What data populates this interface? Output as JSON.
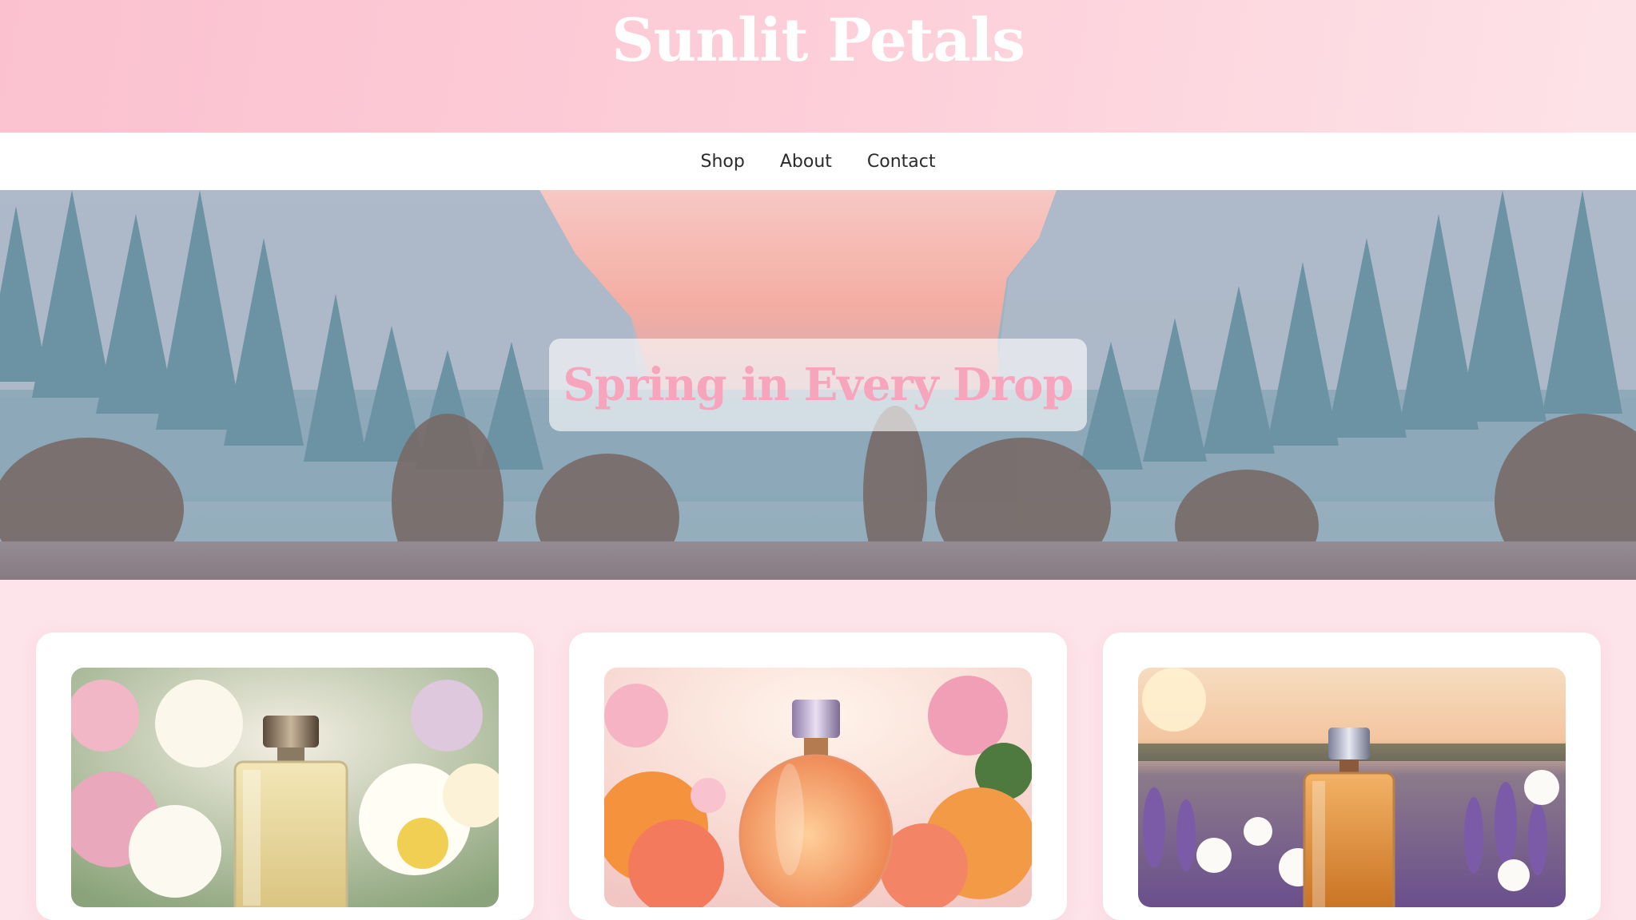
{
  "header": {
    "site_title": "Sunlit Petals"
  },
  "nav": {
    "items": [
      {
        "label": "Shop"
      },
      {
        "label": "About"
      },
      {
        "label": "Contact"
      }
    ]
  },
  "hero": {
    "title": "Spring in Every Drop",
    "image_subject": "misty-forest-sunset"
  },
  "products": [
    {
      "image_subject": "perfume-bottle-white-flowers"
    },
    {
      "image_subject": "perfume-bottle-grapefruit-roses"
    },
    {
      "image_subject": "perfume-bottle-lavender-sunset"
    }
  ],
  "colors": {
    "header_pink": "#fbc1cf",
    "hero_title_pink": "#f7a4bd",
    "page_background": "#fde4ea",
    "nav_text": "#2b2b2b"
  }
}
